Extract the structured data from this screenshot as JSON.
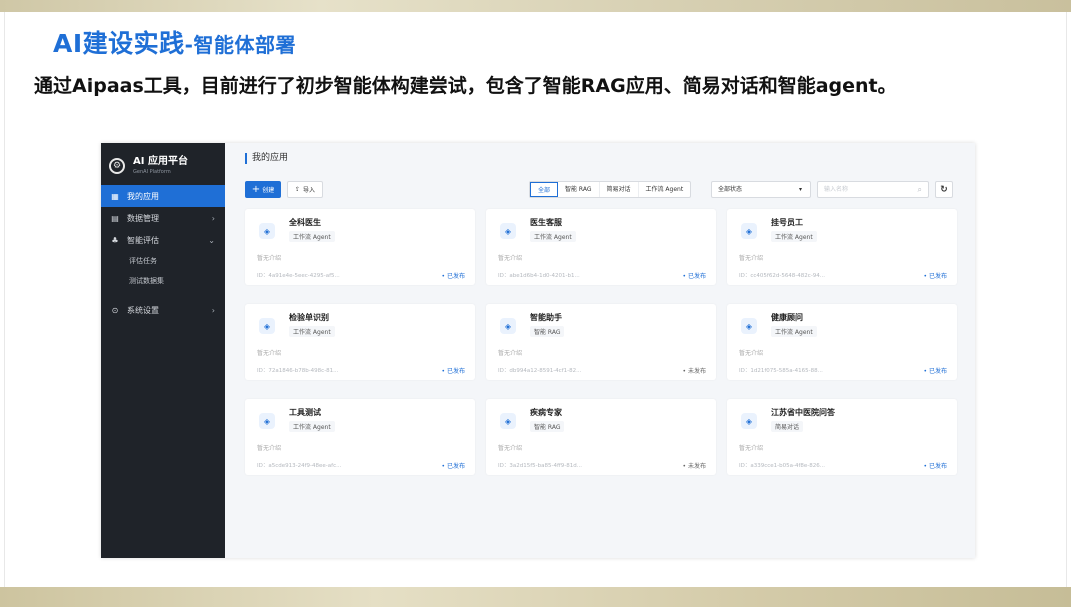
{
  "slide": {
    "title": "AI建设实践",
    "subtitle": "-智能体部署",
    "description": "通过Aipaas工具，目前进行了初步智能体构建尝试，包含了智能RAG应用、简易对话和智能agent。"
  },
  "app": {
    "brand": {
      "name": "AI 应用平台",
      "sub": "GenAI Platform"
    },
    "nav": [
      {
        "label": "我的应用",
        "icon": "grid-icon",
        "glyph": "▦",
        "active": true,
        "chevron": ""
      },
      {
        "label": "数据管理",
        "icon": "database-icon",
        "glyph": "▤",
        "active": false,
        "chevron": "›"
      },
      {
        "label": "智能评估",
        "icon": "evaluation-icon",
        "glyph": "♣",
        "active": false,
        "chevron": "⌄"
      }
    ],
    "nav_sub": [
      "评估任务",
      "测试数据集"
    ],
    "nav_settings": {
      "label": "系统设置",
      "glyph": "⊙",
      "chevron": "›"
    },
    "page_title": "我的应用",
    "toolbar": {
      "create": "创建",
      "import": "导入",
      "filters": [
        "全部",
        "智能 RAG",
        "简易对话",
        "工作流 Agent"
      ],
      "status": "全部状态",
      "search_placeholder": "输入名称"
    },
    "cards": [
      {
        "name": "全科医生",
        "type": "工作流 Agent",
        "desc": "暂无介绍",
        "id": "ID：4a91e4e-5eec-4295-af5...",
        "status": "• 已发布",
        "published": true
      },
      {
        "name": "医生客服",
        "type": "工作流 Agent",
        "desc": "暂无介绍",
        "id": "ID：abe1d6b4-1d0-4201-b1...",
        "status": "• 已发布",
        "published": true
      },
      {
        "name": "挂号员工",
        "type": "工作流 Agent",
        "desc": "暂无介绍",
        "id": "ID：cc405f62d-5648-482c-94...",
        "status": "• 已发布",
        "published": true
      },
      {
        "name": "检验单识别",
        "type": "工作流 Agent",
        "desc": "暂无介绍",
        "id": "ID：72a1846-b78b-498c-81...",
        "status": "• 已发布",
        "published": true
      },
      {
        "name": "智能助手",
        "type": "智能 RAG",
        "desc": "暂无介绍",
        "id": "ID：db994a12-8591-4cf1-82...",
        "status": "• 未发布",
        "published": false
      },
      {
        "name": "健康顾问",
        "type": "工作流 Agent",
        "desc": "暂无介绍",
        "id": "ID：1d21f075-585a-4165-88...",
        "status": "• 已发布",
        "published": true
      },
      {
        "name": "工具测试",
        "type": "工作流 Agent",
        "desc": "暂无介绍",
        "id": "ID：a5cde913-24f9-48ee-afc...",
        "status": "• 已发布",
        "published": true
      },
      {
        "name": "疾病专家",
        "type": "智能 RAG",
        "desc": "暂无介绍",
        "id": "ID：3a2d15f5-ba85-4ff9-81d...",
        "status": "• 未发布",
        "published": false
      },
      {
        "name": "江苏省中医院问答",
        "type": "简易对话",
        "desc": "暂无介绍",
        "id": "ID：a339cce1-b05a-4f8e-826...",
        "status": "• 已发布",
        "published": true
      }
    ]
  }
}
